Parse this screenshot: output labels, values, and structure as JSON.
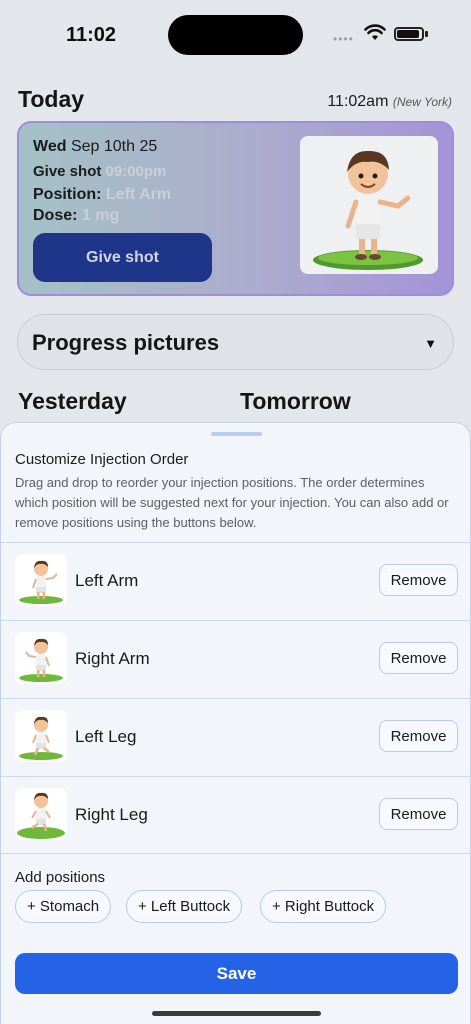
{
  "status_bar": {
    "time": "11:02"
  },
  "today": {
    "title": "Today",
    "time": "11:02am",
    "timezone": "(New York)",
    "card": {
      "date_day": "Wed",
      "date_rest": "Sep 10th 25",
      "give_shot_label": "Give shot",
      "give_shot_time": "09:00pm",
      "position_label": "Position:",
      "position_value": "Left Arm",
      "dose_label": "Dose:",
      "dose_value": "1 mg",
      "button_label": "Give shot"
    }
  },
  "progress_pictures": {
    "label": "Progress pictures",
    "caret": "▼"
  },
  "day_tabs": {
    "yesterday": "Yesterday",
    "tomorrow": "Tomorrow"
  },
  "sheet": {
    "title": "Customize Injection Order",
    "description": "Drag and drop to reorder your injection positions. The order determines which position will be suggested next for your injection. You can also add or remove positions using the buttons below.",
    "positions": [
      {
        "name": "Left Arm",
        "remove_label": "Remove"
      },
      {
        "name": "Right Arm",
        "remove_label": "Remove"
      },
      {
        "name": "Left Leg",
        "remove_label": "Remove"
      },
      {
        "name": "Right Leg",
        "remove_label": "Remove"
      }
    ],
    "add_label": "Add positions",
    "add_options": [
      {
        "label": "+ Stomach"
      },
      {
        "label": "+ Left Buttock"
      },
      {
        "label": "+ Right Buttock"
      }
    ],
    "save_label": "Save"
  },
  "colors": {
    "accent": "#2563e6",
    "card_button": "#1f3589",
    "card_border": "#9b8fd9"
  }
}
